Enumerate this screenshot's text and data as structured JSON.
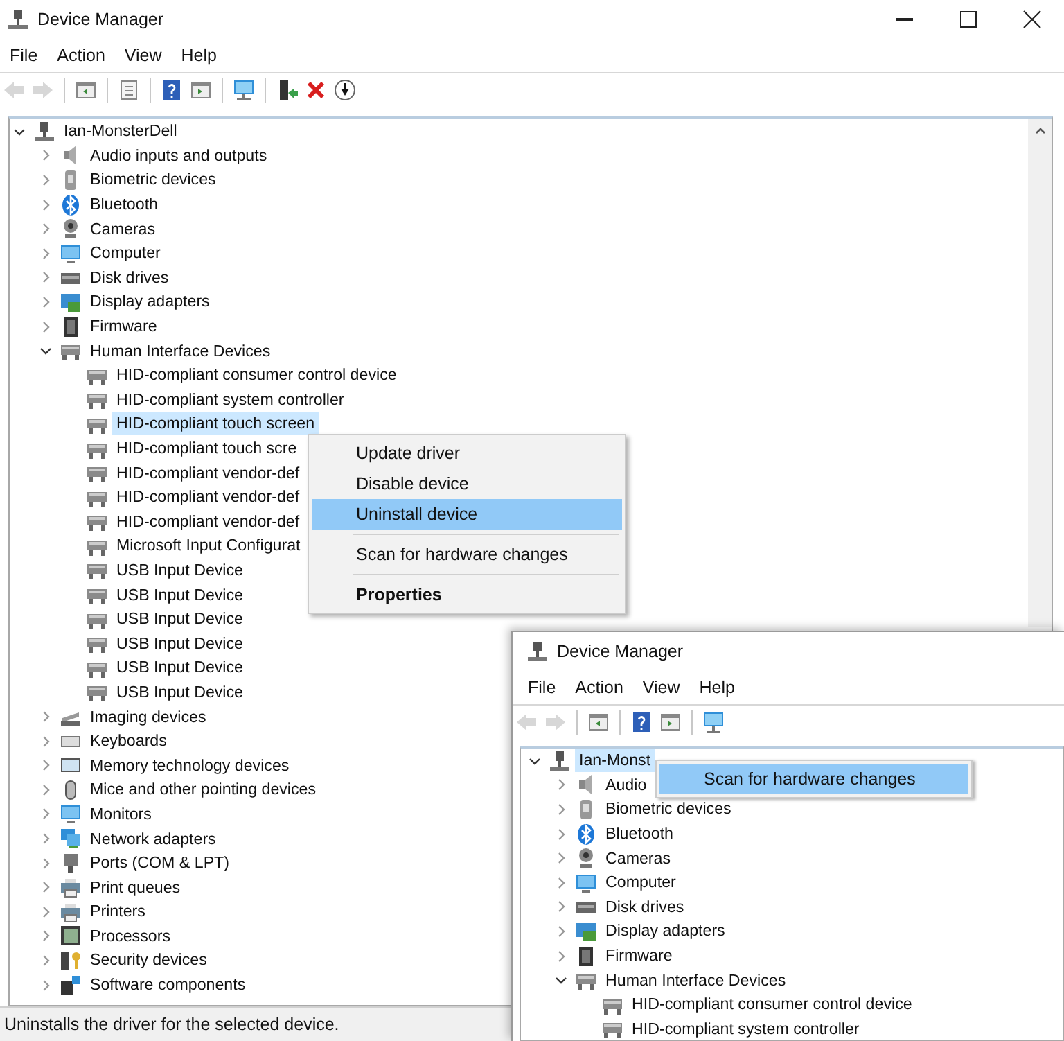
{
  "windows": [
    {
      "title": "Device Manager",
      "caption_buttons": [
        {
          "kind": "minimize"
        },
        {
          "kind": "maximize"
        },
        {
          "kind": "close"
        }
      ],
      "menu": [
        "File",
        "Action",
        "View",
        "Help"
      ],
      "toolbar": [
        {
          "kind": "back",
          "disabled": true
        },
        {
          "kind": "forward",
          "disabled": true
        },
        {
          "kind": "separator"
        },
        {
          "kind": "console_tree",
          "disabled": false
        },
        {
          "kind": "separator"
        },
        {
          "kind": "properties",
          "disabled": false
        },
        {
          "kind": "separator"
        },
        {
          "kind": "help",
          "disabled": false
        },
        {
          "kind": "action_pane",
          "disabled": false
        },
        {
          "kind": "separator"
        },
        {
          "kind": "scan",
          "disabled": false
        },
        {
          "kind": "separator"
        },
        {
          "kind": "update_driver",
          "disabled": false
        },
        {
          "kind": "uninstall",
          "disabled": false
        },
        {
          "kind": "disable",
          "disabled": false
        }
      ],
      "tree": {
        "label": "Ian-MonsterDell",
        "kind": "computer",
        "expanded": true,
        "selected": false,
        "children": [
          {
            "label": "Audio inputs and outputs",
            "kind": "audio",
            "expanded": false,
            "selected": false
          },
          {
            "label": "Biometric devices",
            "kind": "biometric",
            "expanded": false,
            "selected": false
          },
          {
            "label": "Bluetooth",
            "kind": "bluetooth",
            "expanded": false,
            "selected": false
          },
          {
            "label": "Cameras",
            "kind": "camera",
            "expanded": false,
            "selected": false
          },
          {
            "label": "Computer",
            "kind": "monitor",
            "expanded": false,
            "selected": false
          },
          {
            "label": "Disk drives",
            "kind": "disk",
            "expanded": false,
            "selected": false
          },
          {
            "label": "Display adapters",
            "kind": "display",
            "expanded": false,
            "selected": false
          },
          {
            "label": "Firmware",
            "kind": "firmware",
            "expanded": false,
            "selected": false
          },
          {
            "label": "Human Interface Devices",
            "kind": "hid",
            "expanded": true,
            "selected": false,
            "children": [
              {
                "label": "HID-compliant consumer control device",
                "kind": "hid",
                "selected": false
              },
              {
                "label": "HID-compliant system controller",
                "kind": "hid",
                "selected": false
              },
              {
                "label": "HID-compliant touch screen",
                "kind": "hid",
                "selected": true
              },
              {
                "label": "HID-compliant touch scre",
                "kind": "hid",
                "selected": false
              },
              {
                "label": "HID-compliant vendor-def",
                "kind": "hid",
                "selected": false
              },
              {
                "label": "HID-compliant vendor-def",
                "kind": "hid",
                "selected": false
              },
              {
                "label": "HID-compliant vendor-def",
                "kind": "hid",
                "selected": false
              },
              {
                "label": "Microsoft Input Configurat",
                "kind": "hid",
                "selected": false
              },
              {
                "label": "USB Input Device",
                "kind": "hid",
                "selected": false
              },
              {
                "label": "USB Input Device",
                "kind": "hid",
                "selected": false
              },
              {
                "label": "USB Input Device",
                "kind": "hid",
                "selected": false
              },
              {
                "label": "USB Input Device",
                "kind": "hid",
                "selected": false
              },
              {
                "label": "USB Input Device",
                "kind": "hid",
                "selected": false
              },
              {
                "label": "USB Input Device",
                "kind": "hid",
                "selected": false
              }
            ]
          },
          {
            "label": "Imaging devices",
            "kind": "imaging",
            "expanded": false,
            "selected": false
          },
          {
            "label": "Keyboards",
            "kind": "keyboard",
            "expanded": false,
            "selected": false
          },
          {
            "label": "Memory technology devices",
            "kind": "memory",
            "expanded": false,
            "selected": false
          },
          {
            "label": "Mice and other pointing devices",
            "kind": "mouse",
            "expanded": false,
            "selected": false
          },
          {
            "label": "Monitors",
            "kind": "monitor",
            "expanded": false,
            "selected": false
          },
          {
            "label": "Network adapters",
            "kind": "network",
            "expanded": false,
            "selected": false
          },
          {
            "label": "Ports (COM & LPT)",
            "kind": "ports",
            "expanded": false,
            "selected": false
          },
          {
            "label": "Print queues",
            "kind": "printer",
            "expanded": false,
            "selected": false
          },
          {
            "label": "Printers",
            "kind": "printer",
            "expanded": false,
            "selected": false
          },
          {
            "label": "Processors",
            "kind": "processor",
            "expanded": false,
            "selected": false
          },
          {
            "label": "Security devices",
            "kind": "security",
            "expanded": false,
            "selected": false
          },
          {
            "label": "Software components",
            "kind": "software",
            "expanded": false,
            "selected": false
          }
        ]
      },
      "status_bar": "Uninstalls the driver for the selected device.",
      "context_menu": {
        "items": [
          {
            "kind": "command",
            "label": "Update driver",
            "selected": false,
            "default": false
          },
          {
            "kind": "command",
            "label": "Disable device",
            "selected": false,
            "default": false
          },
          {
            "kind": "command",
            "label": "Uninstall device",
            "selected": true,
            "default": false
          },
          {
            "kind": "separator"
          },
          {
            "kind": "command",
            "label": "Scan for hardware changes",
            "selected": false,
            "default": false
          },
          {
            "kind": "separator"
          },
          {
            "kind": "command",
            "label": "Properties",
            "selected": false,
            "default": true
          }
        ]
      }
    },
    {
      "title": "Device Manager",
      "menu": [
        "File",
        "Action",
        "View",
        "Help"
      ],
      "toolbar": [
        {
          "kind": "back",
          "disabled": true
        },
        {
          "kind": "forward",
          "disabled": true
        },
        {
          "kind": "separator"
        },
        {
          "kind": "console_tree",
          "disabled": false
        },
        {
          "kind": "separator"
        },
        {
          "kind": "help",
          "disabled": false
        },
        {
          "kind": "action_pane",
          "disabled": false
        },
        {
          "kind": "separator"
        },
        {
          "kind": "scan",
          "disabled": false
        }
      ],
      "tree": {
        "label": "Ian-Monst",
        "kind": "computer",
        "expanded": true,
        "selected": true,
        "children": [
          {
            "label": "Audio",
            "kind": "audio",
            "expanded": false,
            "selected": false
          },
          {
            "label": "Biometric devices",
            "kind": "biometric",
            "expanded": false,
            "selected": false
          },
          {
            "label": "Bluetooth",
            "kind": "bluetooth",
            "expanded": false,
            "selected": false
          },
          {
            "label": "Cameras",
            "kind": "camera",
            "expanded": false,
            "selected": false
          },
          {
            "label": "Computer",
            "kind": "monitor",
            "expanded": false,
            "selected": false
          },
          {
            "label": "Disk drives",
            "kind": "disk",
            "expanded": false,
            "selected": false
          },
          {
            "label": "Display adapters",
            "kind": "display",
            "expanded": false,
            "selected": false
          },
          {
            "label": "Firmware",
            "kind": "firmware",
            "expanded": false,
            "selected": false
          },
          {
            "label": "Human Interface Devices",
            "kind": "hid",
            "expanded": true,
            "selected": false,
            "children": [
              {
                "label": "HID-compliant consumer control device",
                "kind": "hid",
                "selected": false
              },
              {
                "label": "HID-compliant system controller",
                "kind": "hid",
                "selected": false
              }
            ]
          }
        ]
      },
      "context_menu": {
        "items": [
          {
            "kind": "command",
            "label": "Scan for hardware changes",
            "selected": true,
            "default": false
          }
        ]
      }
    }
  ]
}
